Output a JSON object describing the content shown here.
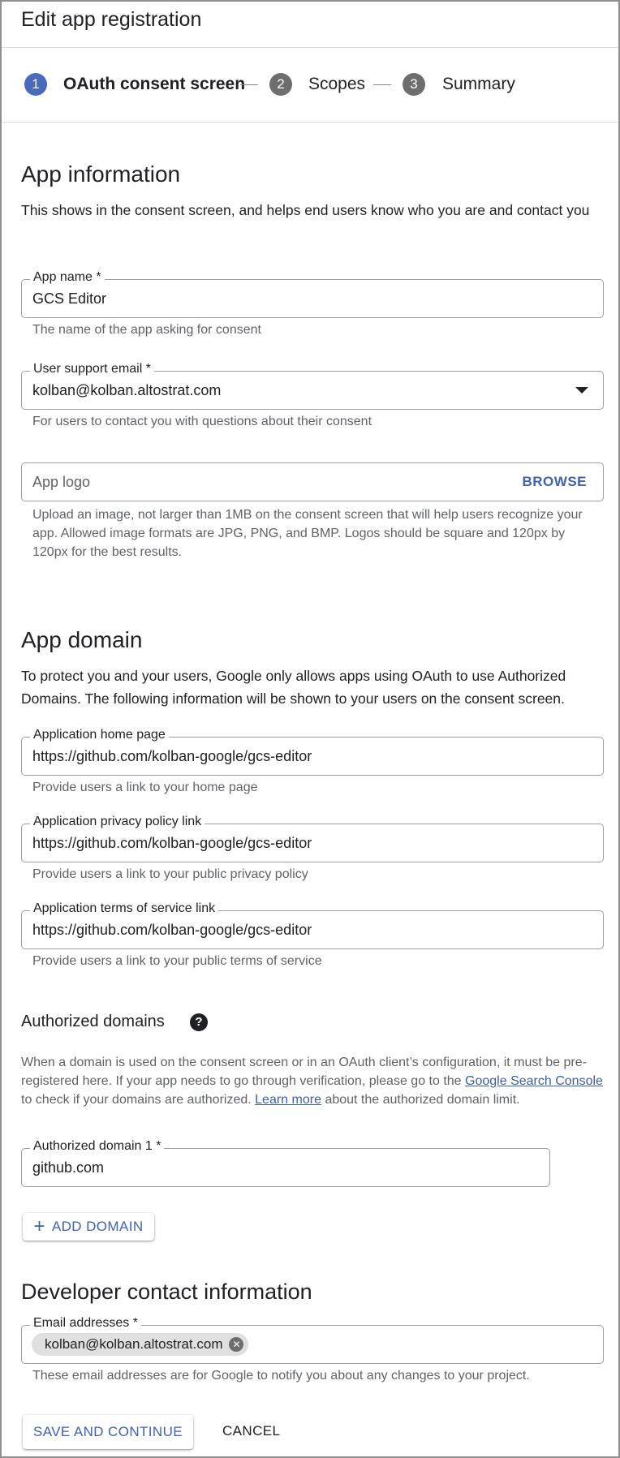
{
  "header": {
    "title": "Edit app registration"
  },
  "stepper": {
    "steps": [
      {
        "number": "1",
        "label": "OAuth consent screen",
        "active": true
      },
      {
        "number": "2",
        "label": "Scopes",
        "active": false
      },
      {
        "number": "3",
        "label": "Summary",
        "active": false
      }
    ],
    "colors": {
      "active": "#4a6bbd",
      "inactive": "#6e6e6e"
    }
  },
  "app_information": {
    "title": "App information",
    "description": "This shows in the consent screen, and helps end users know who you are and contact you",
    "app_name": {
      "label": "App name *",
      "value": "GCS Editor",
      "hint": "The name of the app asking for consent"
    },
    "support_email": {
      "label": "User support email *",
      "value": "kolban@kolban.altostrat.com",
      "hint": "For users to contact you with questions about their consent",
      "icon": "dropdown-arrow-icon"
    },
    "app_logo": {
      "placeholder": "App logo",
      "browse_label": "BROWSE",
      "hint": "Upload an image, not larger than 1MB on the consent screen that will help users recognize your app. Allowed image formats are JPG, PNG, and BMP. Logos should be square and 120px by 120px for the best results."
    }
  },
  "app_domain": {
    "title": "App domain",
    "description": "To protect you and your users, Google only allows apps using OAuth to use Authorized Domains. The following information will be shown to your users on the consent screen.",
    "home_page": {
      "label": "Application home page",
      "value": "https://github.com/kolban-google/gcs-editor",
      "hint": "Provide users a link to your home page"
    },
    "privacy_policy": {
      "label": "Application privacy policy link",
      "value": "https://github.com/kolban-google/gcs-editor",
      "hint": "Provide users a link to your public privacy policy"
    },
    "terms_of_service": {
      "label": "Application terms of service link",
      "value": "https://github.com/kolban-google/gcs-editor",
      "hint": "Provide users a link to your public terms of service"
    }
  },
  "authorized_domains": {
    "title": "Authorized domains",
    "help_icon": "help-circle-icon",
    "text_1": "When a domain is used on the consent screen or in an OAuth client’s configuration, it must be pre-registered here. If your app needs to go through verification, please go to the",
    "link_search_console": "Google Search Console",
    "text_2": "to check if your domains are authorized.",
    "link_learn_more": "Learn more",
    "text_3": "about the authorized domain limit.",
    "domain_1": {
      "label": "Authorized domain 1 *",
      "value": "github.com"
    },
    "add_domain_label": "ADD DOMAIN",
    "add_icon": "plus-icon"
  },
  "developer_contact": {
    "title": "Developer contact information",
    "email": {
      "label": "Email addresses *",
      "chip": "kolban@kolban.altostrat.com",
      "hint": "These email addresses are for Google to notify you about any changes to your project."
    }
  },
  "actions": {
    "save_label": "SAVE AND CONTINUE",
    "cancel_label": "CANCEL"
  }
}
